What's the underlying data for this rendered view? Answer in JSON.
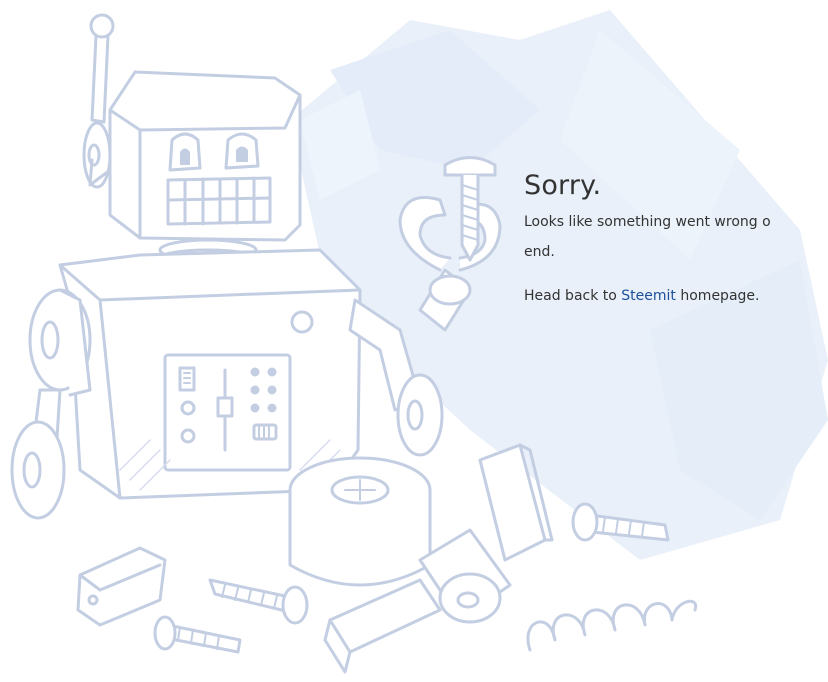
{
  "error": {
    "heading": "Sorry.",
    "line1": "Looks like something went wrong o",
    "line2": "end.",
    "head_back_prefix": "Head back to ",
    "link_label": "Steemit",
    "head_back_suffix": " homepage."
  },
  "illustration": {
    "subject": "broken-robot-with-scattered-parts",
    "icon": "robot-icon"
  },
  "colors": {
    "line_art": "#c5d0e3",
    "wash": "#e6eef8",
    "text": "#333333",
    "link": "#1a5099"
  }
}
